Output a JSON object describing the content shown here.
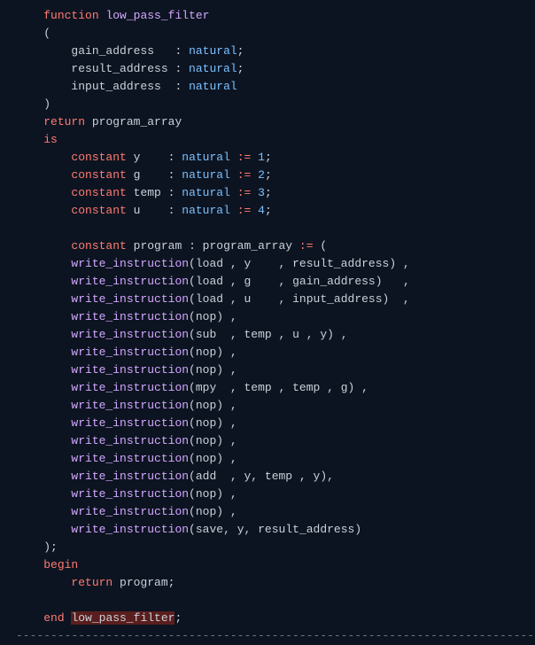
{
  "code": {
    "line1_kw": "function",
    "line1_name": "low_pass_filter",
    "line2": "(",
    "line3_name": "gain_address",
    "line3_type": "natural",
    "line4_name": "result_address",
    "line4_type": "natural",
    "line5_name": "input_address",
    "line5_type": "natural",
    "line6": ")",
    "line7_kw": "return",
    "line7_type": "program_array",
    "line8_kw": "is",
    "const_kw": "constant",
    "nat": "natural",
    "assign": ":=",
    "c1_name": "y",
    "c1_val": "1",
    "c2_name": "g",
    "c2_val": "2",
    "c3_name": "temp",
    "c3_val": "3",
    "c4_name": "u",
    "c4_val": "4",
    "prog_name": "program",
    "prog_type": "program_array",
    "wi": "write_instruction",
    "load": "load",
    "nop": "nop",
    "sub": "sub",
    "mpy": "mpy",
    "add": "add",
    "save": "save",
    "ra": "result_address",
    "ga": "gain_address",
    "ia": "input_address",
    "y": "y",
    "g": "g",
    "u": "u",
    "temp": "temp",
    "close_paren": ");",
    "begin_kw": "begin",
    "return_kw": "return",
    "return_val": "program",
    "end_kw": "end",
    "end_name": "low_pass_filter",
    "dashes": "--------------------------------------------------------------------------------------------"
  }
}
